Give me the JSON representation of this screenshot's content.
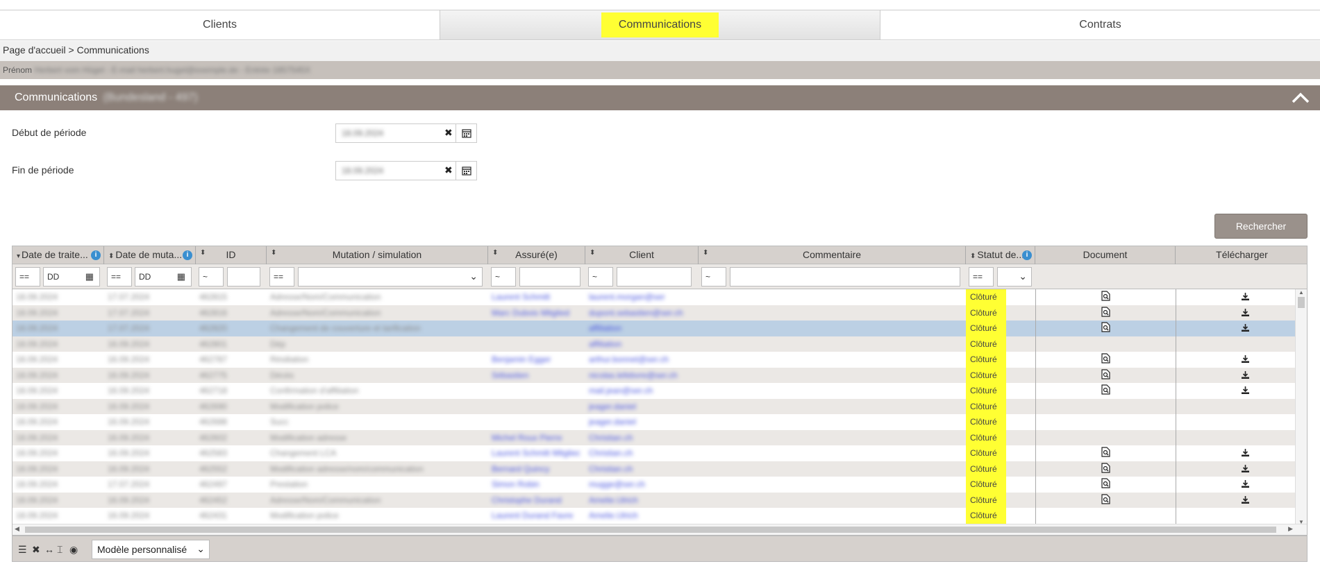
{
  "tabs": [
    {
      "label": "Clients"
    },
    {
      "label": "Communications"
    },
    {
      "label": "Contrats"
    }
  ],
  "breadcrumb": "Page d'accueil > Communications",
  "infobar": {
    "label": "Prénom",
    "value": "Herbert vom Hügel - E-mail herbert.hugel@exemple.de - Entrée 1857545X"
  },
  "panel": {
    "title": "Communications",
    "title_extra": "(Bundesland - 497)"
  },
  "form": {
    "start_label": "Début de période",
    "start_value": "18.09.2024",
    "end_label": "Fin de période",
    "end_value": "18.09.2024"
  },
  "search_label": "Rechercher",
  "grid": {
    "headers": {
      "date_traitement": "Date de traite...",
      "date_mutation": "Date de muta...",
      "id": "ID",
      "mutation": "Mutation / simulation",
      "assure": "Assuré(e)",
      "client": "Client",
      "commentaire": "Commentaire",
      "statut": "Statut de...",
      "document": "Document",
      "telecharger": "Télécharger"
    },
    "filters": {
      "eq": "==",
      "tilde": "~",
      "dd": "DD"
    },
    "rows": [
      {
        "date1": "18.09.2024",
        "date2": "17.07.2024",
        "id": "462815",
        "mutation": "Adresse/Nom/Communication",
        "assure": "Laurent Schmitt",
        "client": "laurent.morgan@ser",
        "status": "Clôturé",
        "doc": true,
        "dl": true
      },
      {
        "date1": "18.09.2024",
        "date2": "17.07.2024",
        "id": "462816",
        "mutation": "Adresse/Nom/Communication",
        "assure": "Marc Dubois Mitglied",
        "client": "dupont.sebastien@ser.ch",
        "status": "Clôturé",
        "doc": true,
        "dl": true
      },
      {
        "date1": "18.09.2024",
        "date2": "17.07.2024",
        "id": "462820",
        "mutation": "Changement de couverture et tarification",
        "assure": "",
        "client": "affiliation",
        "status": "Clôturé",
        "doc": true,
        "dl": true
      },
      {
        "date1": "18.09.2024",
        "date2": "16.09.2024",
        "id": "462801",
        "mutation": "Dép",
        "assure": "",
        "client": "affiliation",
        "status": "Clôturé",
        "doc": false,
        "dl": false
      },
      {
        "date1": "18.09.2024",
        "date2": "16.09.2024",
        "id": "462787",
        "mutation": "Résiliation",
        "assure": "Benjamin Egger",
        "client": "arthur.bonnet@ser.ch",
        "status": "Clôturé",
        "doc": true,
        "dl": true
      },
      {
        "date1": "18.09.2024",
        "date2": "16.09.2024",
        "id": "462775",
        "mutation": "Décès",
        "assure": "Sébastien",
        "client": "nicolas.lefebvre@ser.ch",
        "status": "Clôturé",
        "doc": true,
        "dl": true
      },
      {
        "date1": "18.09.2024",
        "date2": "16.09.2024",
        "id": "462718",
        "mutation": "Confirmation d'affiliation",
        "assure": "",
        "client": "mail.jean@ser.ch",
        "status": "Clôturé",
        "doc": true,
        "dl": true
      },
      {
        "date1": "18.09.2024",
        "date2": "16.09.2024",
        "id": "462690",
        "mutation": "Modification police",
        "assure": "",
        "client": "jeager.daniel",
        "status": "Clôturé",
        "doc": false,
        "dl": false
      },
      {
        "date1": "18.09.2024",
        "date2": "16.09.2024",
        "id": "462688",
        "mutation": "Succ",
        "assure": "",
        "client": "jeager.daniel",
        "status": "Clôturé",
        "doc": false,
        "dl": false
      },
      {
        "date1": "18.09.2024",
        "date2": "16.09.2024",
        "id": "462602",
        "mutation": "Modification adresse",
        "assure": "Michel Roux Pierre",
        "client": "Christian.ch",
        "status": "Clôturé",
        "doc": false,
        "dl": false
      },
      {
        "date1": "18.09.2024",
        "date2": "16.09.2024",
        "id": "462583",
        "mutation": "Changement LCA",
        "assure": "Laurent Schmitt Mitglied",
        "client": "Christian.ch",
        "status": "Clôturé",
        "doc": true,
        "dl": true
      },
      {
        "date1": "18.09.2024",
        "date2": "16.09.2024",
        "id": "462552",
        "mutation": "Modification adresse/nom/communication",
        "assure": "Bernard Quincy",
        "client": "Christian.ch",
        "status": "Clôturé",
        "doc": true,
        "dl": true
      },
      {
        "date1": "18.09.2024",
        "date2": "17.07.2024",
        "id": "462497",
        "mutation": "Prestation",
        "assure": "Simon Robin",
        "client": "mugge@ser.ch",
        "status": "Clôturé",
        "doc": true,
        "dl": true
      },
      {
        "date1": "18.09.2024",
        "date2": "16.09.2024",
        "id": "462452",
        "mutation": "Adresse/Nom/Communication",
        "assure": "Christophe Durand",
        "client": "Amelie.Ulrich",
        "status": "Clôturé",
        "doc": true,
        "dl": true
      },
      {
        "date1": "18.09.2024",
        "date2": "16.09.2024",
        "id": "462431",
        "mutation": "Modification police",
        "assure": "Laurent Durand Favre",
        "client": "Amelie.Ulrich",
        "status": "Clôturé",
        "doc": false,
        "dl": false
      }
    ]
  },
  "footer": {
    "model_select": "Modèle personnalisé"
  },
  "colors": {
    "highlight": "#ffff33",
    "panel": "#8c8079",
    "selected_row": "#bcd0e4",
    "link": "#4a56e0"
  }
}
